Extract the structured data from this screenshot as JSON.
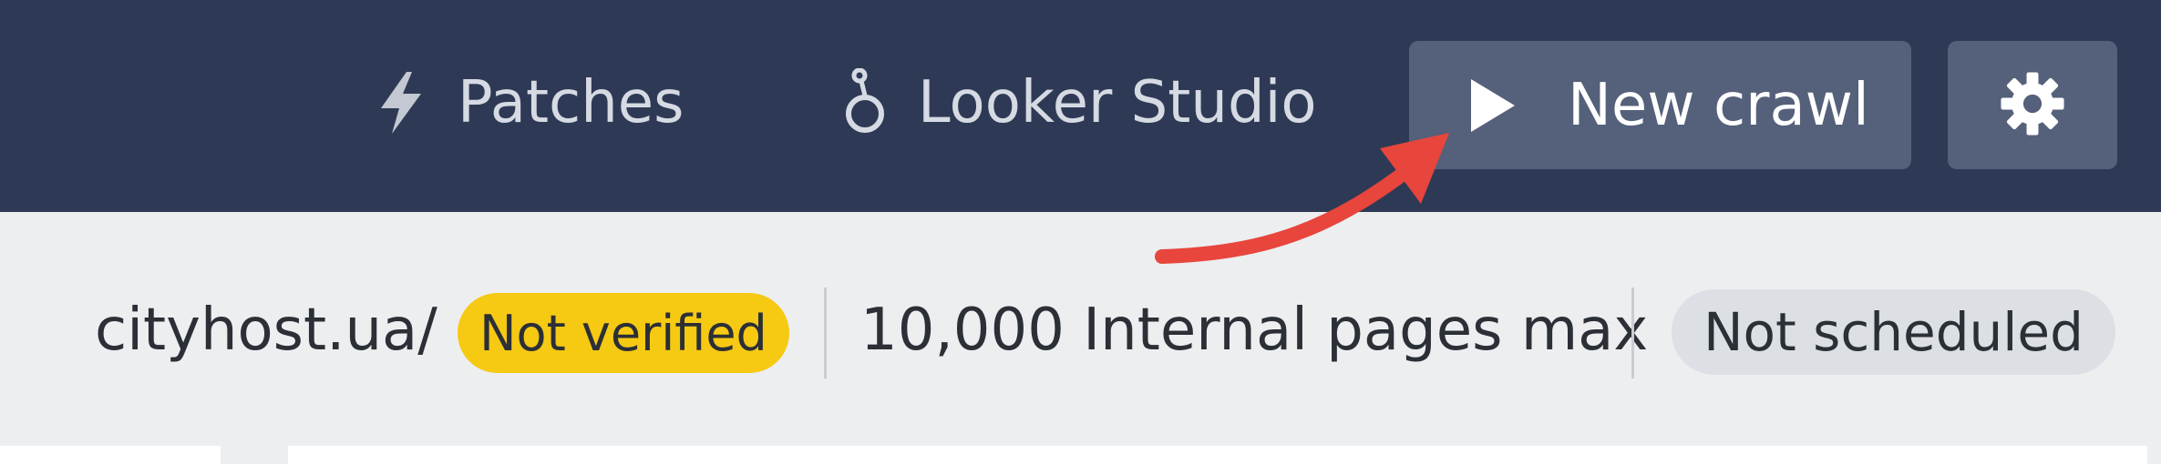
{
  "header": {
    "patches_label": "Patches",
    "looker_label": "Looker Studio",
    "new_crawl_label": "New crawl"
  },
  "info": {
    "domain": "cityhost.ua/",
    "verification_status": "Not verified",
    "pages_limit": "10,000 Internal pages max",
    "schedule_status": "Not scheduled"
  },
  "colors": {
    "topbar": "#2e3a55",
    "button": "#55607a",
    "verify_badge": "#f6c913",
    "annotation_arrow": "#e8453c"
  },
  "icons": {
    "patches": "lightning-bolt-icon",
    "looker": "looker-studio-icon",
    "new_crawl": "play-icon",
    "settings": "gear-icon"
  }
}
